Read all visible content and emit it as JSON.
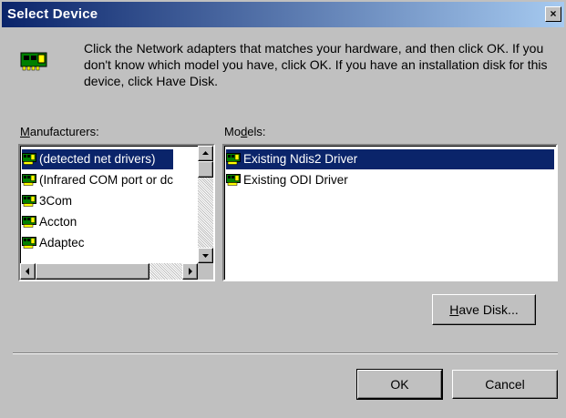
{
  "window": {
    "title": "Select Device",
    "close_glyph": "×"
  },
  "intro": {
    "icon": "network-adapter-icon",
    "text": "Click the Network adapters that matches your hardware, and then click OK. If you don't know which model you have, click OK. If you have an installation disk for this device, click Have Disk."
  },
  "manufacturers": {
    "label_mnemonic": "M",
    "label_rest": "anufacturers:",
    "items": [
      {
        "label": "(detected net drivers)",
        "selected": true
      },
      {
        "label": "(Infrared COM port or dc",
        "selected": false
      },
      {
        "label": "3Com",
        "selected": false
      },
      {
        "label": "Accton",
        "selected": false
      },
      {
        "label": "Adaptec",
        "selected": false
      }
    ]
  },
  "models": {
    "label_pre": "Mo",
    "label_mnemonic": "d",
    "label_rest": "els:",
    "items": [
      {
        "label": "Existing Ndis2 Driver",
        "selected": true
      },
      {
        "label": "Existing ODI Driver",
        "selected": false
      }
    ]
  },
  "buttons": {
    "have_disk_mnemonic": "H",
    "have_disk_rest": "ave Disk...",
    "ok": "OK",
    "cancel": "Cancel"
  },
  "colors": {
    "selection": "#0a246a",
    "face": "#c0c0c0",
    "title_start": "#0a246a",
    "title_end": "#a6caf0"
  }
}
